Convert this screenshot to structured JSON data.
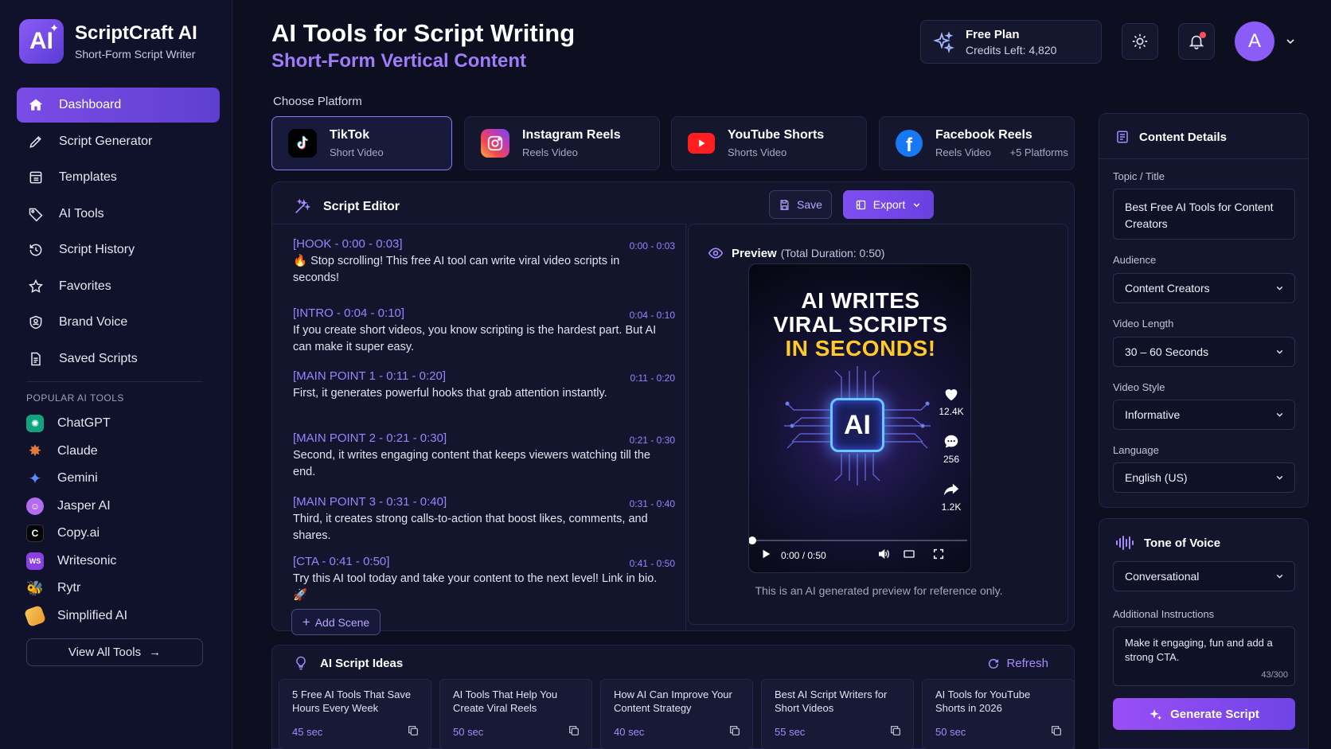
{
  "brand": {
    "logo_text": "AI",
    "name": "ScriptCraft AI",
    "tagline": "Short-Form Script Writer"
  },
  "nav": [
    {
      "label": "Dashboard",
      "icon": "home-icon",
      "active": true
    },
    {
      "label": "Script Generator",
      "icon": "pen-icon"
    },
    {
      "label": "Templates",
      "icon": "template-icon"
    },
    {
      "label": "AI Tools",
      "icon": "tag-icon"
    },
    {
      "label": "Script History",
      "icon": "history-icon"
    },
    {
      "label": "Favorites",
      "icon": "star-icon"
    },
    {
      "label": "Brand Voice",
      "icon": "brand-icon"
    },
    {
      "label": "Saved Scripts",
      "icon": "document-icon"
    }
  ],
  "popular_tools": {
    "title": "POPULAR AI TOOLS",
    "items": [
      {
        "label": "ChatGPT",
        "color": "#10a37f"
      },
      {
        "label": "Claude",
        "color": "#e07a3c"
      },
      {
        "label": "Gemini",
        "color": "#5b8cff"
      },
      {
        "label": "Jasper AI",
        "color": "#b36cf0"
      },
      {
        "label": "Copy.ai",
        "color": "#0b0b0b",
        "glyph": "C"
      },
      {
        "label": "Writesonic",
        "color": "#8b3fe0",
        "glyph": "WS"
      },
      {
        "label": "Rytr",
        "color": "#f0b030"
      },
      {
        "label": "Simplified AI",
        "color": "#f2b54a"
      }
    ],
    "view_all": "View All Tools"
  },
  "header": {
    "title": "AI Tools for Script Writing",
    "subtitle": "Short-Form Vertical Content",
    "plan_title": "Free Plan",
    "plan_credits": "Credits Left: 4,820",
    "avatar_letter": "A"
  },
  "platforms": {
    "label": "Choose Platform",
    "items": [
      {
        "name": "TikTok",
        "sub": "Short Video",
        "active": true
      },
      {
        "name": "Instagram Reels",
        "sub": "Reels Video"
      },
      {
        "name": "YouTube Shorts",
        "sub": "Shorts Video"
      },
      {
        "name": "Facebook Reels",
        "sub": "Reels Video",
        "extra": "+5 Platforms"
      }
    ]
  },
  "editor": {
    "title": "Script Editor",
    "save_label": "Save",
    "export_label": "Export",
    "scenes": [
      {
        "head": "[HOOK - 0:00 - 0:03]",
        "time": "0:00 - 0:03",
        "text": "🔥 Stop scrolling! This free AI tool can write viral video scripts in seconds!"
      },
      {
        "head": "[INTRO - 0:04 - 0:10]",
        "time": "0:04 - 0:10",
        "text": "If you create short videos, you know scripting is the hardest part. But AI can make it super easy."
      },
      {
        "head": "[MAIN POINT 1 - 0:11 - 0:20]",
        "time": "0:11 - 0:20",
        "text": "First, it generates powerful hooks that grab attention instantly."
      },
      {
        "head": "[MAIN POINT 2 - 0:21 - 0:30]",
        "time": "0:21 - 0:30",
        "text": "Second, it writes engaging content that keeps viewers watching till the end."
      },
      {
        "head": "[MAIN POINT 3 - 0:31 - 0:40]",
        "time": "0:31 - 0:40",
        "text": "Third, it creates strong calls-to-action that boost likes, comments, and shares."
      },
      {
        "head": "[CTA - 0:41 - 0:50]",
        "time": "0:41 - 0:50",
        "text": "Try this AI tool today and take your content to the next level! Link in bio. 🚀"
      }
    ],
    "add_scene": "Add Scene"
  },
  "preview": {
    "label": "Preview",
    "duration": "(Total Duration: 0:50)",
    "headline_1": "AI WRITES",
    "headline_2": "VIRAL SCRIPTS",
    "headline_3": "IN SECONDS!",
    "chip_text": "AI",
    "likes": "12.4K",
    "comments": "256",
    "shares": "1.2K",
    "time": "0:00 / 0:50",
    "progress": 0,
    "note": "This is an AI generated preview for reference only."
  },
  "ideas": {
    "title": "AI Script Ideas",
    "refresh": "Refresh",
    "items": [
      {
        "text": "5 Free AI Tools That Save Hours Every Week",
        "dur": "45 sec"
      },
      {
        "text": "AI Tools That Help You Create Viral Reels",
        "dur": "50 sec"
      },
      {
        "text": "How AI Can Improve Your Content Strategy",
        "dur": "40 sec"
      },
      {
        "text": "Best AI Script Writers for Short Videos",
        "dur": "55 sec"
      },
      {
        "text": "AI Tools for YouTube Shorts in 2026",
        "dur": "50 sec"
      }
    ]
  },
  "details": {
    "title": "Content Details",
    "topic_label": "Topic / Title",
    "topic_value": "Best Free AI Tools for Content Creators",
    "audience_label": "Audience",
    "audience_value": "Content Creators",
    "length_label": "Video Length",
    "length_value": "30 – 60 Seconds",
    "style_label": "Video Style",
    "style_value": "Informative",
    "language_label": "Language",
    "language_value": "English (US)"
  },
  "tone": {
    "title": "Tone of Voice",
    "value": "Conversational",
    "instructions_label": "Additional Instructions",
    "instructions_value": "Make it engaging, fun and add a strong CTA.",
    "char_count": "43/300",
    "generate_label": "Generate Script"
  },
  "colors": {
    "accent": "#7b4ce6",
    "accent_text": "#9c82ff",
    "background": "#0d0e1f",
    "panel": "#13152c"
  }
}
